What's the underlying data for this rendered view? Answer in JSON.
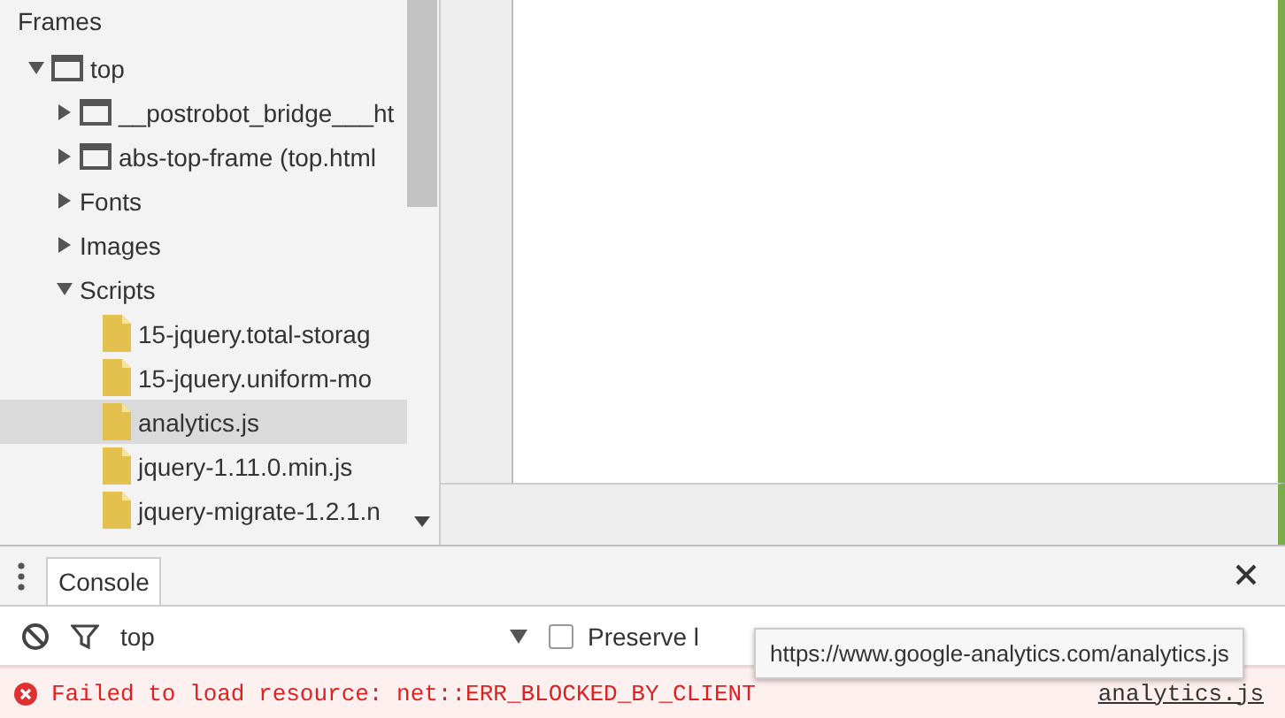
{
  "sidebar": {
    "title": "Frames",
    "tree": [
      {
        "kind": "frame",
        "label": "top",
        "expanded": true,
        "selected": false,
        "children": [
          {
            "kind": "frame",
            "label": "__postrobot_bridge___ht",
            "expanded": false,
            "selected": false
          },
          {
            "kind": "frame",
            "label": "abs-top-frame (top.html",
            "expanded": false,
            "selected": false
          },
          {
            "kind": "folder",
            "label": "Fonts",
            "expanded": false,
            "selected": false
          },
          {
            "kind": "folder",
            "label": "Images",
            "expanded": false,
            "selected": false
          },
          {
            "kind": "folder",
            "label": "Scripts",
            "expanded": true,
            "selected": false,
            "children": [
              {
                "kind": "file",
                "label": "15-jquery.total-storag",
                "selected": false
              },
              {
                "kind": "file",
                "label": "15-jquery.uniform-mo",
                "selected": false
              },
              {
                "kind": "file",
                "label": "analytics.js",
                "selected": true
              },
              {
                "kind": "file",
                "label": "jquery-1.11.0.min.js",
                "selected": false
              },
              {
                "kind": "file",
                "label": "jquery-migrate-1.2.1.n",
                "selected": false
              }
            ]
          }
        ]
      }
    ]
  },
  "console": {
    "tabs": [
      {
        "label": "Console",
        "selected": true
      }
    ],
    "toolbar": {
      "context": "top",
      "preserve_log": {
        "label": "Preserve l",
        "checked": false
      }
    },
    "messages": [
      {
        "kind": "error",
        "text": "Failed to load resource: net::ERR_BLOCKED_BY_CLIENT",
        "source": "analytics.js"
      }
    ],
    "tooltip": "https://www.google-analytics.com/analytics.js"
  }
}
